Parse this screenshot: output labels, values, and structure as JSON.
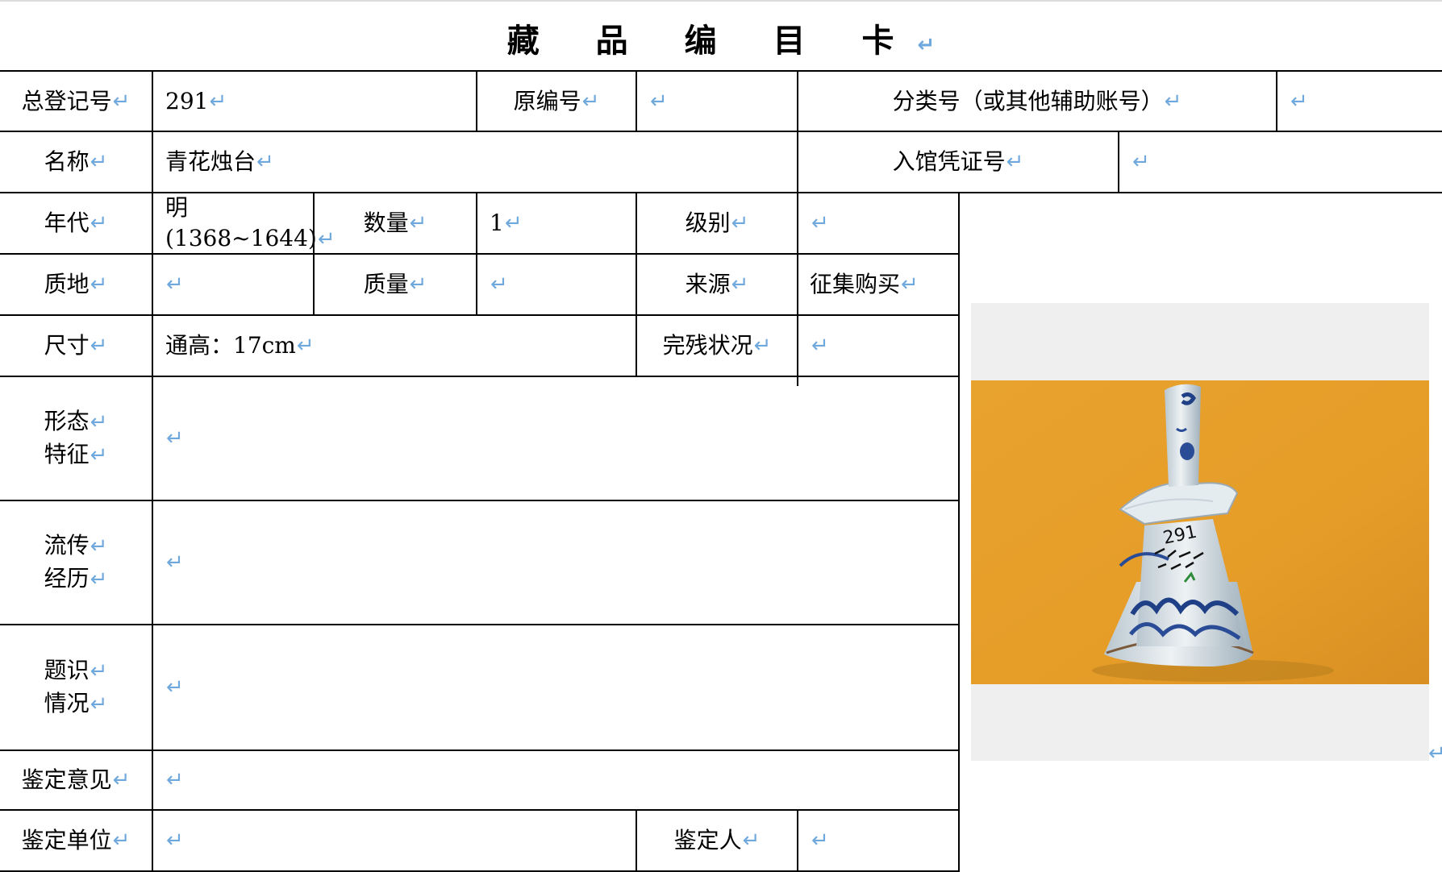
{
  "title": "藏 品 编 目 卡",
  "return_mark": "↵",
  "rows": {
    "total_reg_no": {
      "label": "总登记号",
      "value": "291"
    },
    "original_no": {
      "label": "原编号",
      "value": ""
    },
    "category_no": {
      "label": "分类号（或其他辅助账号）",
      "value": ""
    },
    "name": {
      "label": "名称",
      "value": "青花烛台"
    },
    "entry_voucher": {
      "label": "入馆凭证号",
      "value": ""
    },
    "era": {
      "label": "年代",
      "value_line1": "明",
      "value_line2": "(1368~1644)"
    },
    "quantity": {
      "label": "数量",
      "value": "1"
    },
    "grade": {
      "label": "级别",
      "value": ""
    },
    "material": {
      "label": "质地",
      "value": ""
    },
    "weight": {
      "label": "质量",
      "value": ""
    },
    "source": {
      "label": "来源",
      "value": "征集购买"
    },
    "size": {
      "label": "尺寸",
      "value": "通高：17cm"
    },
    "condition": {
      "label": "完残状况",
      "value": ""
    },
    "form": {
      "label_line1": "形态",
      "label_line2": "特征",
      "value": ""
    },
    "provenance": {
      "label_line1": "流传",
      "label_line2": "经历",
      "value": ""
    },
    "inscription": {
      "label_line1": "题识",
      "label_line2": "情况",
      "value": ""
    },
    "appraisal_opinion": {
      "label": "鉴定意见",
      "value": ""
    },
    "appraisal_unit": {
      "label": "鉴定单位",
      "value": ""
    },
    "appraiser": {
      "label": "鉴定人",
      "value": ""
    }
  },
  "photo": {
    "subject": "blue-and-white porcelain candlestick fragment",
    "handwritten_marks": "291"
  },
  "colors": {
    "return_mark": "#6fa8dc",
    "photo_background": "#e6a02c",
    "photo_frame": "#efefef"
  }
}
